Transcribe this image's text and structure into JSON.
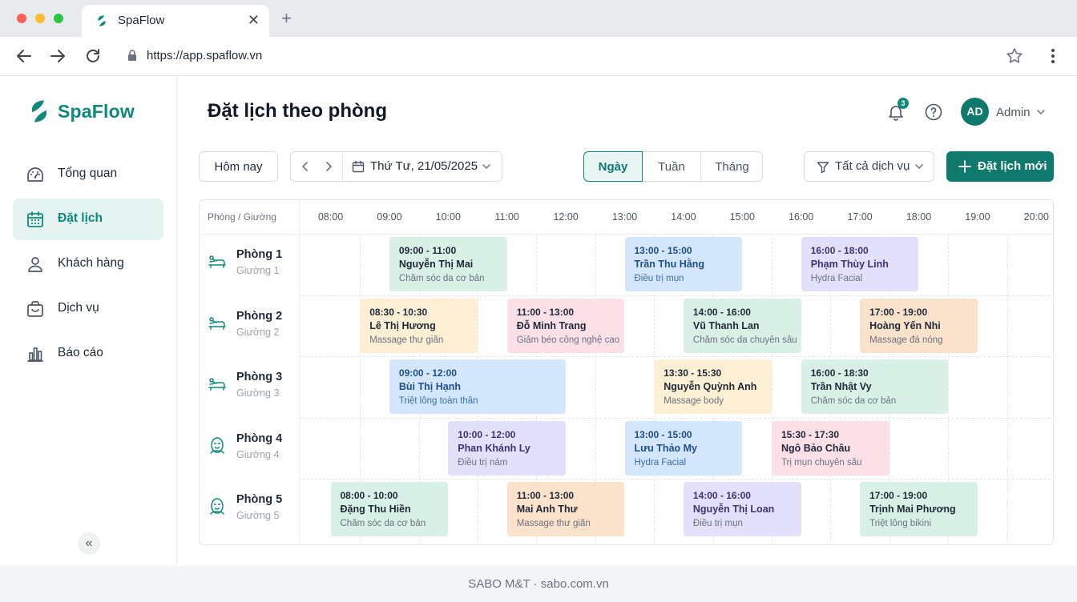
{
  "browser": {
    "tab_title": "SpaFlow",
    "url": "https://app.spaflow.vn"
  },
  "brand": {
    "name": "SpaFlow",
    "color": "#0f8a7a"
  },
  "sidebar": {
    "items": [
      {
        "label": "Tổng quan",
        "icon": "dashboard-icon",
        "active": false
      },
      {
        "label": "Đặt lịch",
        "icon": "calendar-icon",
        "active": true
      },
      {
        "label": "Khách hàng",
        "icon": "user-icon",
        "active": false
      },
      {
        "label": "Dịch vụ",
        "icon": "shopping-bag-icon",
        "active": false
      },
      {
        "label": "Báo cáo",
        "icon": "bar-chart-icon",
        "active": false
      }
    ],
    "collapse_glyph": "«"
  },
  "header": {
    "title": "Đặt lịch theo phòng",
    "notification_count": "3",
    "avatar_initials": "AD",
    "user_name": "Admin"
  },
  "toolbar": {
    "today_label": "Hôm nay",
    "date_label": "Thứ Tư, 21/05/2025",
    "views": [
      "Ngày",
      "Tuần",
      "Tháng"
    ],
    "active_view": "Ngày",
    "filter_label": "Tất cả dịch vụ",
    "new_booking_label": "Đặt lịch mới"
  },
  "schedule": {
    "corner_label": "Phòng / Giường",
    "hours": [
      "08:00",
      "09:00",
      "10:00",
      "11:00",
      "12:00",
      "13:00",
      "14:00",
      "15:00",
      "16:00",
      "17:00",
      "18:00",
      "19:00",
      "20:00"
    ],
    "rooms": [
      {
        "name": "Phòng 1",
        "bed": "Giường 1",
        "icon": "massage-bed-icon"
      },
      {
        "name": "Phòng 2",
        "bed": "Giường 2",
        "icon": "massage-bed-icon"
      },
      {
        "name": "Phòng 3",
        "bed": "Giường 3",
        "icon": "massage-bed-icon"
      },
      {
        "name": "Phòng 4",
        "bed": "Giường 4",
        "icon": "face-mask-icon"
      },
      {
        "name": "Phòng 5",
        "bed": "Giường 5",
        "icon": "face-mask-icon"
      }
    ],
    "bookings": [
      {
        "room": 0,
        "time": "09:00 - 11:00",
        "customer": "Nguyễn Thị Mai",
        "service": "Chăm sóc da cơ bản",
        "color": "green"
      },
      {
        "room": 0,
        "time": "13:00 - 15:00",
        "customer": "Trần Thu Hằng",
        "service": "Điều trị mụn",
        "color": "blue"
      },
      {
        "room": 0,
        "time": "16:00 - 18:00",
        "customer": "Phạm Thùy Linh",
        "service": "Hydra Facial",
        "color": "purple"
      },
      {
        "room": 1,
        "time": "08:30 - 10:30",
        "customer": "Lê Thị Hương",
        "service": "Massage thư giãn",
        "color": "yellow"
      },
      {
        "room": 1,
        "time": "11:00 - 13:00",
        "customer": "Đỗ Minh Trang",
        "service": "Giảm béo công nghệ cao",
        "color": "pink"
      },
      {
        "room": 1,
        "time": "14:00 - 16:00",
        "customer": "Vũ Thanh Lan",
        "service": "Chăm sóc da chuyên sâu",
        "color": "green"
      },
      {
        "room": 1,
        "time": "17:00 - 19:00",
        "customer": "Hoàng Yến Nhi",
        "service": "Massage đá nóng",
        "color": "orange"
      },
      {
        "room": 2,
        "time": "09:00 - 12:00",
        "customer": "Bùi Thị Hạnh",
        "service": "Triệt lông toàn thân",
        "color": "blue"
      },
      {
        "room": 2,
        "time": "13:30 - 15:30",
        "customer": "Nguyễn Quỳnh Anh",
        "service": "Massage body",
        "color": "yellow"
      },
      {
        "room": 2,
        "time": "16:00 - 18:30",
        "customer": "Trần Nhật Vy",
        "service": "Chăm sóc da cơ bản",
        "color": "green"
      },
      {
        "room": 3,
        "time": "10:00 - 12:00",
        "customer": "Phan Khánh Ly",
        "service": "Điều trị nám",
        "color": "purple"
      },
      {
        "room": 3,
        "time": "13:00 - 15:00",
        "customer": "Lưu Thảo My",
        "service": "Hydra Facial",
        "color": "blue"
      },
      {
        "room": 3,
        "time": "15:30 - 17:30",
        "customer": "Ngô Bảo Châu",
        "service": "Trị mụn chuyên sâu",
        "color": "pink"
      },
      {
        "room": 4,
        "time": "08:00 - 10:00",
        "customer": "Đặng Thu Hiền",
        "service": "Chăm sóc da cơ bản",
        "color": "green"
      },
      {
        "room": 4,
        "time": "11:00 - 13:00",
        "customer": "Mai Anh Thư",
        "service": "Massage thư giãn",
        "color": "orange"
      },
      {
        "room": 4,
        "time": "14:00 - 16:00",
        "customer": "Nguyễn Thị Loan",
        "service": "Điều trị mụn",
        "color": "purple"
      },
      {
        "room": 4,
        "time": "17:00 - 19:00",
        "customer": "Trịnh Mai Phương",
        "service": "Triệt lông bikini",
        "color": "green"
      }
    ]
  },
  "footer": {
    "text": "SABO M&T · sabo.com.vn"
  }
}
